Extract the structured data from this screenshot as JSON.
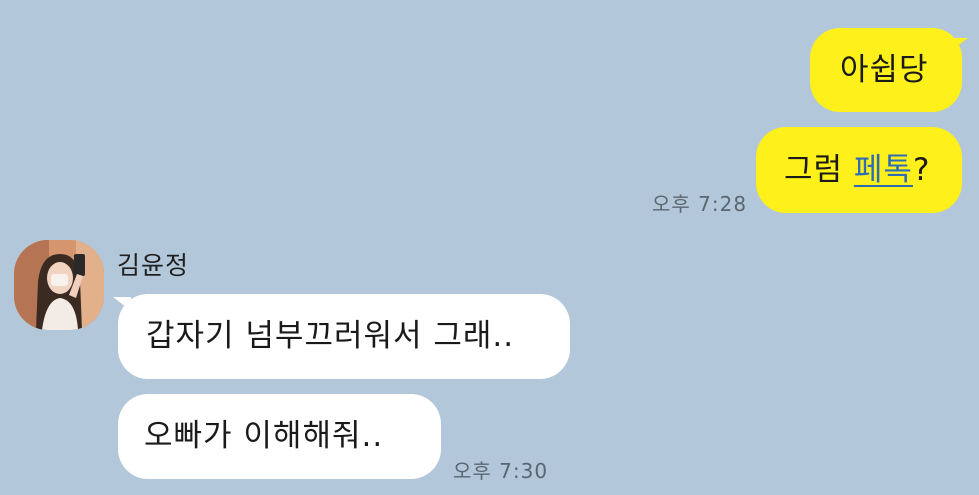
{
  "conversation": {
    "sender_name": "김윤정",
    "sent": [
      {
        "text": "아쉽당"
      },
      {
        "prefix": "그럼 ",
        "link": "페톡",
        "suffix": "?",
        "time": "오후 7:28"
      }
    ],
    "received": [
      {
        "text": "갑자기 넘부끄러워서 그래.."
      },
      {
        "text": "오빠가 이해해줘..",
        "time": "오후 7:30"
      }
    ]
  },
  "colors": {
    "background": "#b2c7d9",
    "sent_bubble": "#fef01b",
    "received_bubble": "#ffffff",
    "link": "#2e6db4"
  },
  "icons": {
    "avatar": "profile-photo-avatar"
  }
}
